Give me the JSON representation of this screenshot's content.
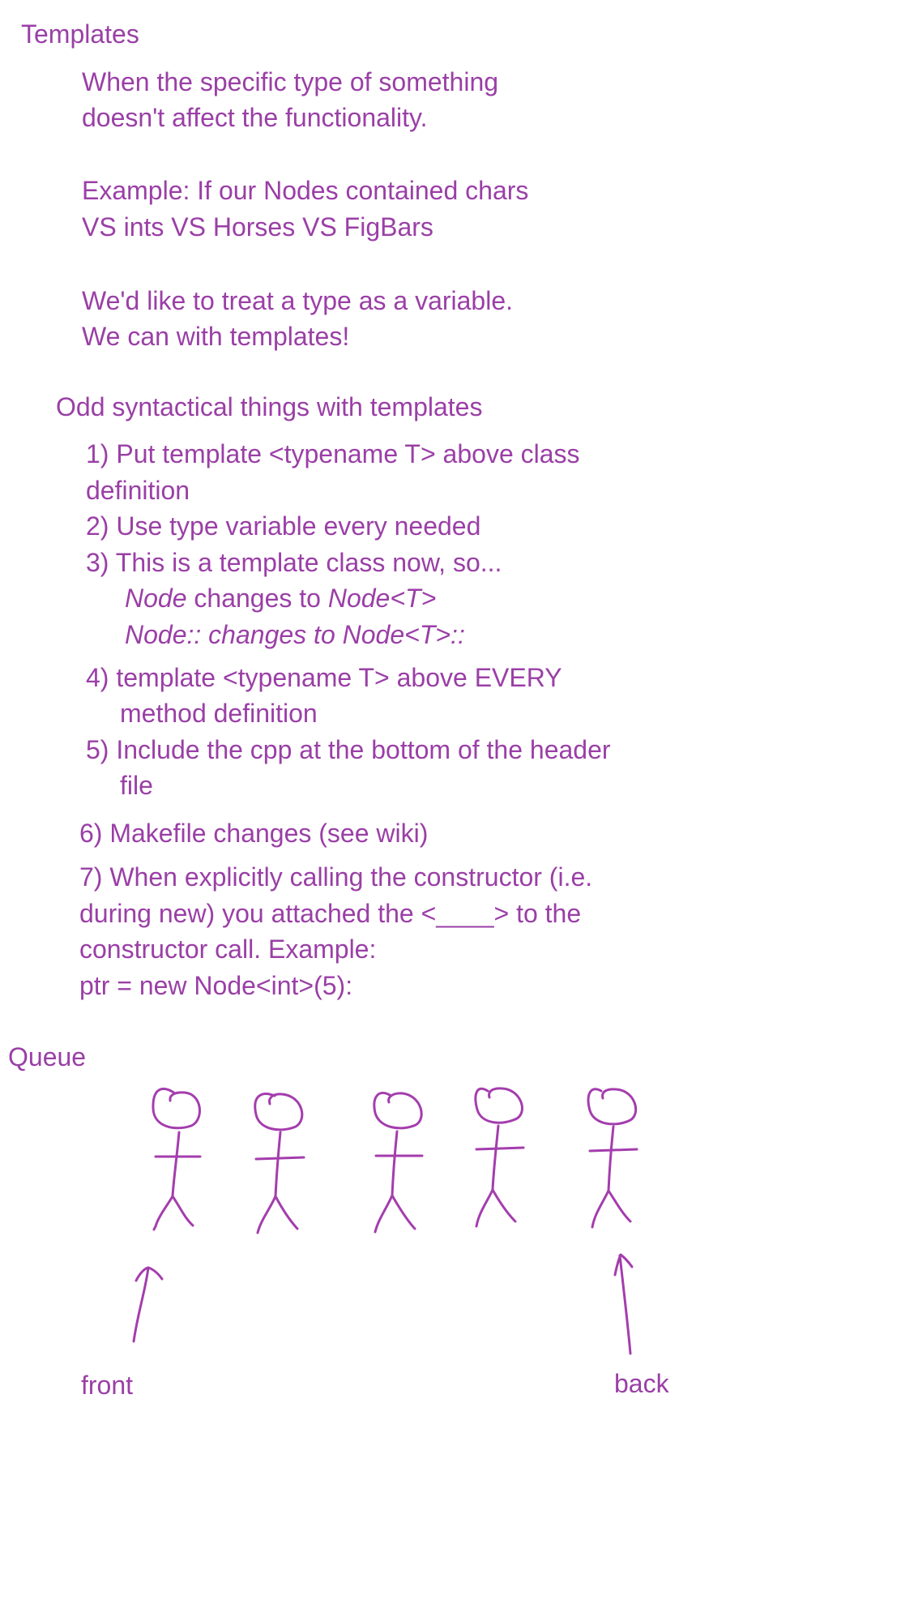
{
  "templates": {
    "title": "Templates",
    "intro": [
      "When the specific type of something",
      "doesn't affect the functionality."
    ],
    "example": [
      "Example: If our Nodes contained chars",
      "VS ints VS Horses VS FigBars"
    ],
    "variable": [
      "We'd like to treat a type as a variable.",
      "We can with templates!"
    ]
  },
  "syntax": {
    "title": "Odd syntactical things with templates",
    "items": [
      {
        "lines": [
          "1) Put template <typename T> above class",
          "definition"
        ]
      },
      {
        "lines": [
          "2) Use type variable every needed"
        ]
      },
      {
        "lines": [
          "3) This is a template class now, so..."
        ]
      },
      {
        "lines": [
          "4) template <typename T> above EVERY",
          "method definition"
        ]
      },
      {
        "lines": [
          "5) Include the cpp at the bottom of the header",
          "file"
        ]
      },
      {
        "lines": [
          "6) Makefile changes (see wiki)"
        ]
      },
      {
        "lines": [
          "7) When explicitly calling the constructor (i.e.",
          "during new) you attached the <____> to the",
          "constructor call. Example:",
          "ptr = new Node<int>(5):"
        ]
      }
    ],
    "sub3": {
      "line1_italic_a": "Node",
      "line1_plain": " changes to ",
      "line1_italic_b": "Node<T>",
      "line2_italic": "Node:: changes to Node<T>::"
    }
  },
  "queue": {
    "title": "Queue",
    "people_count_drawn": 5,
    "front_label": "front",
    "back_label": "back"
  }
}
